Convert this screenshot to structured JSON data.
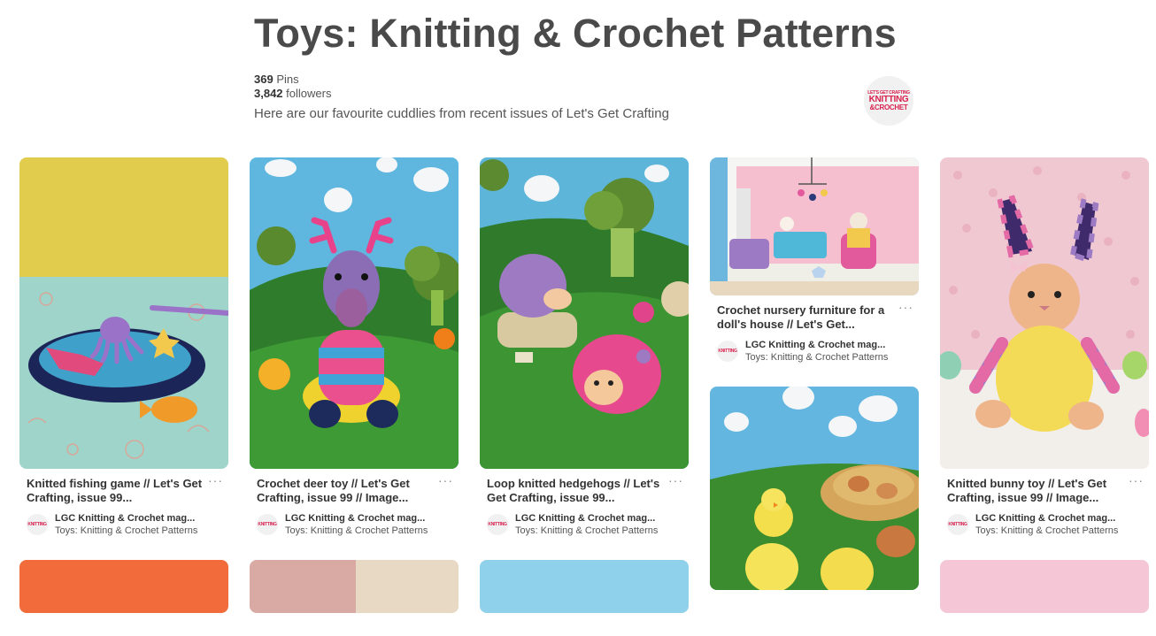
{
  "board": {
    "title": "Toys: Knitting & Crochet Patterns",
    "pins_count": "369",
    "pins_label": "Pins",
    "followers_count": "3,842",
    "followers_label": "followers",
    "description": "Here are our favourite cuddlies from recent issues of Let's Get Crafting",
    "owner_logo": {
      "line1": "LET'S GET CRAFTING",
      "line2": "KNITTING",
      "line3": "&CROCHET"
    }
  },
  "more_glyph": "···",
  "pins": [
    {
      "title": "Knitted fishing game // Let's Get Crafting, issue 99...",
      "source": "LGC Knitting & Crochet mag...",
      "board": "Toys: Knitting & Crochet Patterns"
    },
    {
      "title": "Crochet deer toy // Let's Get Crafting, issue 99 // Image...",
      "source": "LGC Knitting & Crochet mag...",
      "board": "Toys: Knitting & Crochet Patterns"
    },
    {
      "title": "Loop knitted hedgehogs // Let's Get Crafting, issue 99...",
      "source": "LGC Knitting & Crochet mag...",
      "board": "Toys: Knitting & Crochet Patterns"
    },
    {
      "title": "Crochet nursery furniture for a doll's house // Let's Get...",
      "source": "LGC Knitting & Crochet mag...",
      "board": "Toys: Knitting & Crochet Patterns"
    },
    {
      "title": "Knitted bunny toy // Let's Get Crafting, issue 99 // Image...",
      "source": "LGC Knitting & Crochet mag...",
      "board": "Toys: Knitting & Crochet Patterns"
    }
  ],
  "colors": {
    "title": "#4a4a4a",
    "brand_red": "#d9214f"
  }
}
